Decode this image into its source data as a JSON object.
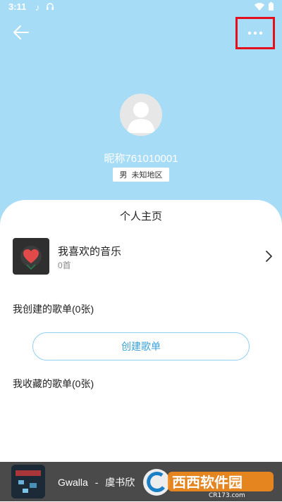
{
  "status_bar": {
    "time": "3:11"
  },
  "profile": {
    "nickname": "昵称761010001",
    "gender": "男",
    "region": "未知地区"
  },
  "card": {
    "title": "个人主页",
    "favorites": {
      "name": "我喜欢的音乐",
      "count": "0首"
    },
    "created_section": "我创建的歌单(0张)",
    "create_button": "创建歌单",
    "collected_section": "我收藏的歌单(0张)"
  },
  "player": {
    "artist": "Gwalla",
    "separator": "-",
    "title": "虞书欣"
  },
  "watermark": {
    "brand": "西西软件园",
    "url": "CR173.com"
  },
  "colors": {
    "header_bg": "#a7dcf6",
    "accent": "#3ba3d8",
    "highlight_box": "#e3101c",
    "player_bg": "#4a4a4a"
  },
  "icons": [
    "back-arrow-icon",
    "more-dots-icon",
    "avatar-icon",
    "heart-icon",
    "chevron-right-icon"
  ]
}
